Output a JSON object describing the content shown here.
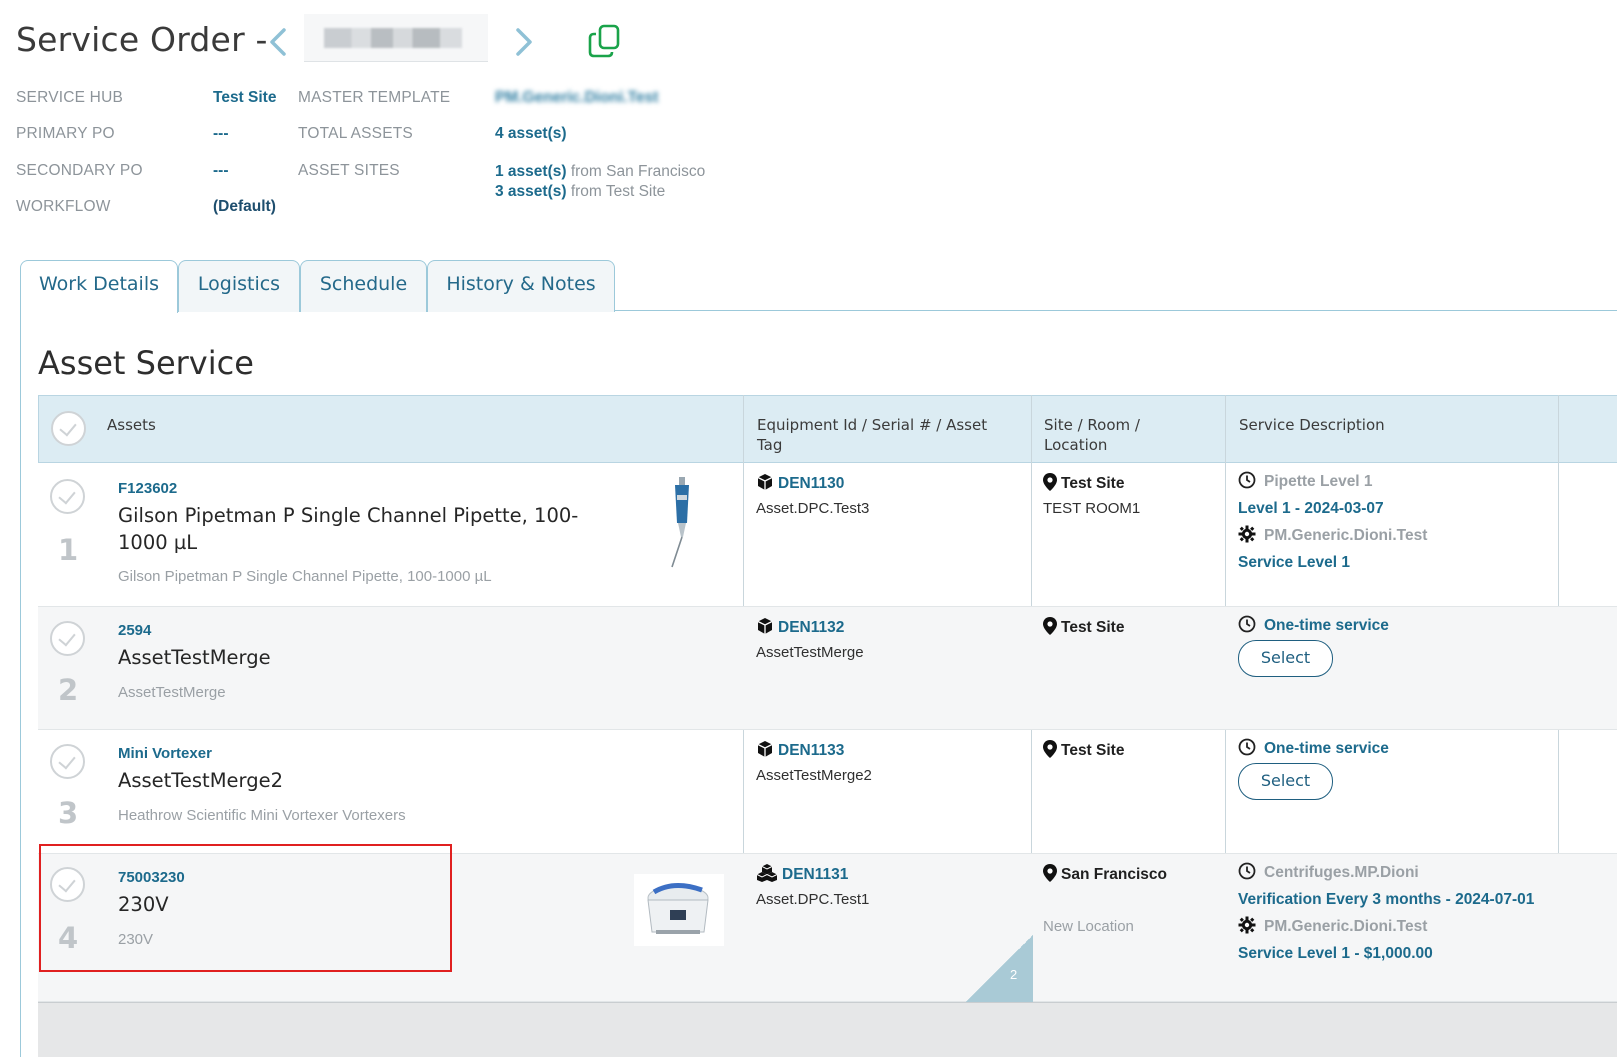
{
  "header": {
    "title": "Service Order -",
    "copy_icon": "copy-icon",
    "prev_icon": "chevron-left-icon",
    "next_icon": "chevron-right-icon"
  },
  "info": {
    "service_hub_label": "SERVICE HUB",
    "service_hub_value": "Test Site",
    "master_template_label": "MASTER TEMPLATE",
    "master_template_value": "PM.Generic.Dioni.Test",
    "primary_po_label": "PRIMARY PO",
    "primary_po_value": "---",
    "total_assets_label": "TOTAL ASSETS",
    "total_assets_value": "4 asset(s)",
    "secondary_po_label": "SECONDARY PO",
    "secondary_po_value": "---",
    "asset_sites_label": "ASSET SITES",
    "asset_sites": [
      {
        "count": "1 asset(s)",
        "text": "from San Francisco"
      },
      {
        "count": "3 asset(s)",
        "text": "from Test Site"
      }
    ],
    "workflow_label": "WORKFLOW",
    "workflow_value": "(Default)"
  },
  "tabs": [
    {
      "label": "Work Details",
      "active": true
    },
    {
      "label": "Logistics",
      "active": false
    },
    {
      "label": "Schedule",
      "active": false
    },
    {
      "label": "History & Notes",
      "active": false
    }
  ],
  "section_title": "Asset Service",
  "table": {
    "headers": {
      "assets": "Assets",
      "equipment_line1": "Equipment Id / Serial # / Asset",
      "equipment_line2": "Tag",
      "site_line1": "Site / Room /",
      "site_line2": "Location",
      "service": "Service Description"
    },
    "rows": [
      {
        "num": "1",
        "code": "F123602",
        "name": "Gilson Pipetman P Single Channel Pipette, 100-1000 µL",
        "desc": "Gilson Pipetman P Single Channel Pipette, 100-1000 µL",
        "eq_id": "DEN1130",
        "eq_icon": "box-icon",
        "eq_tag": "Asset.DPC.Test3",
        "site": "Test Site",
        "room": "TEST ROOM1",
        "svc_line1": "Pipette Level 1",
        "svc_line2": "Level 1 - 2024-03-07",
        "svc_line3": "PM.Generic.Dioni.Test",
        "svc_line4": "Service Level 1"
      },
      {
        "num": "2",
        "code": "2594",
        "name": "AssetTestMerge",
        "desc": "AssetTestMerge",
        "eq_id": "DEN1132",
        "eq_icon": "box-icon",
        "eq_tag": "AssetTestMerge",
        "site": "Test Site",
        "svc_line1": "One-time service",
        "select_label": "Select"
      },
      {
        "num": "3",
        "code": "Mini Vortexer",
        "name": "AssetTestMerge2",
        "desc": "Heathrow Scientific Mini Vortexer Vortexers",
        "eq_id": "DEN1133",
        "eq_icon": "box-icon",
        "eq_tag": "AssetTestMerge2",
        "site": "Test Site",
        "svc_line1": "One-time service",
        "select_label": "Select"
      },
      {
        "num": "4",
        "code": "75003230",
        "name": "230V",
        "desc": "230V",
        "eq_id": "DEN1131",
        "eq_icon": "boxes-icon",
        "eq_tag": "Asset.DPC.Test1",
        "site": "San Francisco",
        "room": "New Location",
        "svc_line1": "Centrifuges.MP.Dioni",
        "svc_line2": "Verification Every 3 months - 2024-07-01",
        "svc_line3": "PM.Generic.Dioni.Test",
        "svc_line4": "Service Level 1 - $1,000.00",
        "corner_count": "2"
      }
    ]
  },
  "colors": {
    "link": "#1c6a8c",
    "header_bg": "#dcecf3",
    "highlight": "#e02020"
  }
}
